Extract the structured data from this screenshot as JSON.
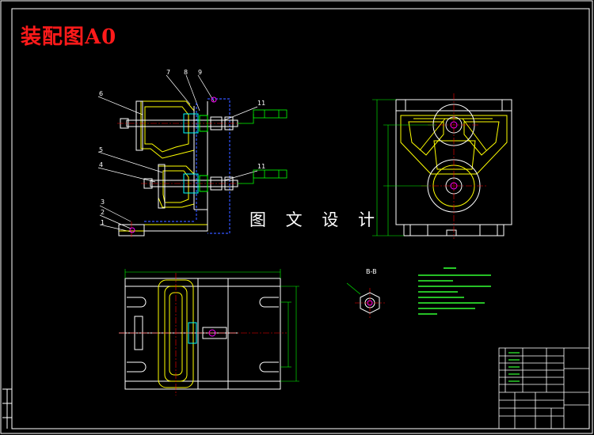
{
  "drawing": {
    "title": "装配图A0",
    "watermark": "图 文 设 计",
    "section_label": "B-B"
  },
  "part_numbers": [
    "1",
    "2",
    "3",
    "4",
    "5",
    "6",
    "7",
    "8",
    "9",
    "11",
    "11"
  ],
  "colors": {
    "background": "#000000",
    "frame": "#ffffff",
    "title": "#ff1a1a",
    "outline": "#ffffff",
    "hidden_line": "#ffff00",
    "center_line": "#ff0000",
    "dimension": "#00ff00",
    "bolt_blue": "#3355ff",
    "cyan": "#00ffff",
    "magenta": "#ff00ff",
    "notes": "#33ff33"
  }
}
